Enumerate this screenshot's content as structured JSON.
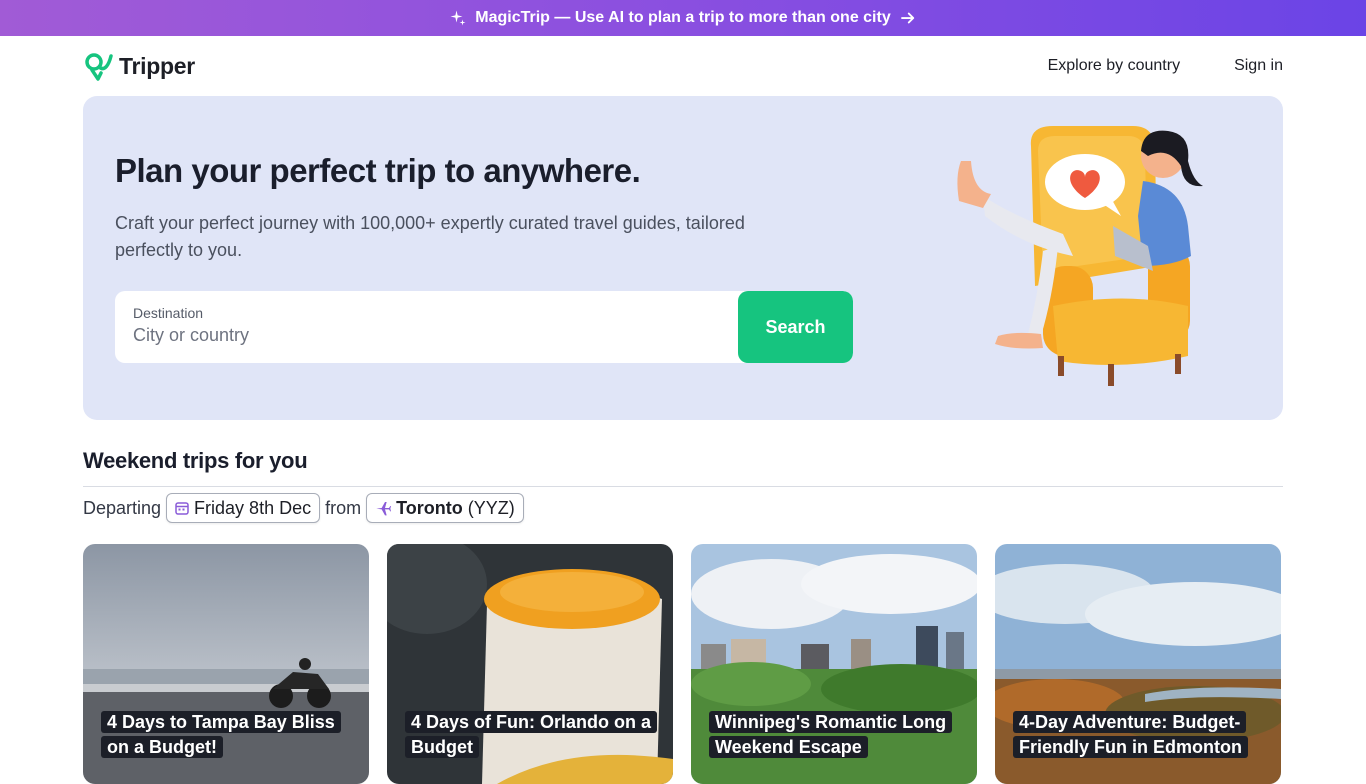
{
  "banner": {
    "text": "MagicTrip — Use AI to plan a trip to more than one city"
  },
  "brand": {
    "name": "Tripper",
    "accent": "#16c47f"
  },
  "nav": {
    "explore": "Explore by country",
    "signin": "Sign in"
  },
  "hero": {
    "title": "Plan your perfect trip to anywhere.",
    "subtitle": "Craft your perfect journey with 100,000+ expertly curated travel guides, tailored perfectly to you.",
    "search": {
      "label": "Destination",
      "placeholder": "City or country",
      "button": "Search"
    }
  },
  "weekend": {
    "title": "Weekend trips for you",
    "departing_label": "Departing",
    "date": "Friday 8th Dec",
    "from_label": "from",
    "origin_city": "Toronto",
    "origin_code": "(YYZ)"
  },
  "cards": [
    {
      "title": "4 Days to Tampa Bay Bliss on a Budget!"
    },
    {
      "title": "4 Days of Fun: Orlando on a Budget"
    },
    {
      "title": "Winnipeg's Romantic Long Weekend Escape"
    },
    {
      "title": "4-Day Adventure: Budget-Friendly Fun in Edmonton"
    }
  ]
}
